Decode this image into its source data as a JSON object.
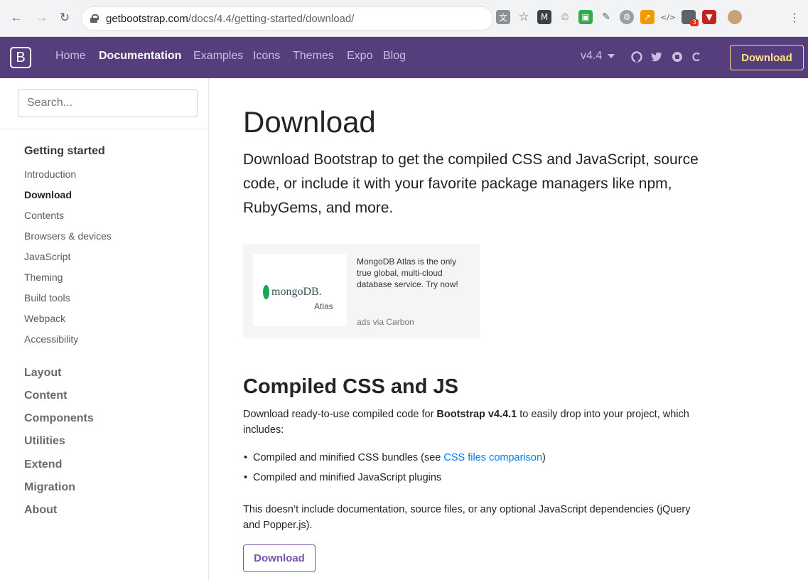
{
  "browser": {
    "url_host": "getbootstrap.com",
    "url_path": "/docs/4.4/getting-started/download/",
    "badge_count": "3"
  },
  "navbar": {
    "brand": "B",
    "links": [
      "Home",
      "Documentation",
      "Examples",
      "Icons",
      "Themes",
      "Expo",
      "Blog"
    ],
    "version": "v4.4",
    "download_label": "Download",
    "colors": {
      "bg": "#563d7c",
      "accent": "#ffe484"
    }
  },
  "sidebar": {
    "search_placeholder": "Search...",
    "section_title": "Getting started",
    "sub_items": [
      "Introduction",
      "Download",
      "Contents",
      "Browsers & devices",
      "JavaScript",
      "Theming",
      "Build tools",
      "Webpack",
      "Accessibility"
    ],
    "top_items": [
      "Layout",
      "Content",
      "Components",
      "Utilities",
      "Extend",
      "Migration",
      "About"
    ]
  },
  "main": {
    "title": "Download",
    "lead": "Download Bootstrap to get the compiled CSS and JavaScript, source code, or include it with your favorite package managers like npm, RubyGems, and more.",
    "ad": {
      "brand": "mongoDB.",
      "sub": "Atlas",
      "text": "MongoDB Atlas is the only true global, multi-cloud database service. Try now!",
      "via": "ads via Carbon"
    },
    "section_title": "Compiled CSS and JS",
    "intro_pre": "Download ready-to-use compiled code for ",
    "intro_bold": "Bootstrap v4.4.1",
    "intro_post": " to easily drop into your project, which includes:",
    "bullet1_pre": "Compiled and minified CSS bundles (see ",
    "bullet1_link": "CSS files comparison",
    "bullet1_post": ")",
    "bullet2": "Compiled and minified JavaScript plugins",
    "note": "This doesn’t include documentation, source files, or any optional JavaScript dependencies (jQuery and Popper.js).",
    "download_button": "Download"
  }
}
